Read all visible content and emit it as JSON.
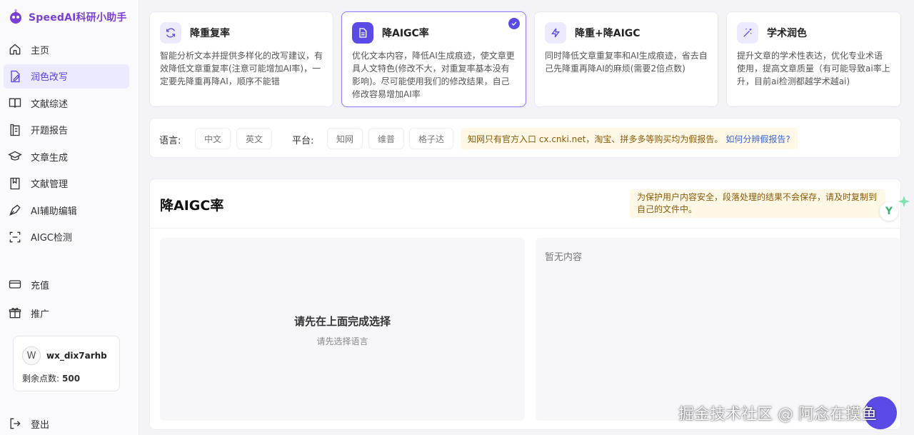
{
  "app": {
    "name": "SpeedAI科研小助手"
  },
  "sidebar": {
    "items": [
      {
        "label": "主页",
        "icon": "home-icon"
      },
      {
        "label": "润色改写",
        "icon": "edit-doc-icon",
        "active": true
      },
      {
        "label": "文献综述",
        "icon": "book-icon"
      },
      {
        "label": "开题报告",
        "icon": "report-icon"
      },
      {
        "label": "文章生成",
        "icon": "graduation-cap-icon"
      },
      {
        "label": "文献管理",
        "icon": "bookmark-icon"
      },
      {
        "label": "AI辅助编辑",
        "icon": "pen-icon"
      },
      {
        "label": "AIGC检测",
        "icon": "scan-icon"
      }
    ],
    "bottom": [
      {
        "label": "充值",
        "icon": "card-icon"
      },
      {
        "label": "推广",
        "icon": "gift-icon"
      }
    ],
    "user": {
      "avatar": "W",
      "name": "wx_dix7arhb",
      "points_label": "剩余点数:",
      "points": "500"
    },
    "logout": "登出"
  },
  "modes": [
    {
      "title": "降重复率",
      "icon": "refresh-icon",
      "desc": "智能分析文本并提供多样化的改写建议，有效降低文章重复率(注意可能增加AI率)，一定要先降重再降AI，顺序不能错"
    },
    {
      "title": "降AIGC率",
      "icon": "document-icon",
      "selected": true,
      "desc": "优化文本内容，降低AI生成痕迹，使文章更具人文特色(修改不大，对重复率基本没有影响)。尽可能使用我们的修改结果，自己修改容易增加AI率"
    },
    {
      "title": "降重+降AIGC",
      "icon": "lightning-icon",
      "desc": "同时降低文章重复率和AI生成痕迹，省去自己先降重再降AI的麻烦(需要2倍点数)"
    },
    {
      "title": "学术润色",
      "icon": "magic-wand-icon",
      "desc": "提升文章的学术性表达，优化专业术语使用，提高文章质量（有可能导致ai率上升，目前ai检测都越学术越ai)"
    }
  ],
  "options": {
    "language_label": "语言:",
    "languages": [
      "中文",
      "英文"
    ],
    "platform_label": "平台:",
    "platforms": [
      "知网",
      "维普",
      "格子达"
    ],
    "notice": "知网只有官方入口 cx.cnki.net，淘宝、拼多多等购买均为假报告。",
    "notice_link": "如何分辨假报告?"
  },
  "panel": {
    "title": "降AIGC率",
    "safety_notice": "为保护用户内容安全，段落处理的结果不会保存，请及时复制到自己的文件中。",
    "left_title": "请先在上面完成选择",
    "left_sub": "请先选择语言",
    "right_empty": "暂无内容"
  },
  "watermark": "掘金技术社区 @ 阿念在摸鱼",
  "colors": {
    "accent": "#5a4be6",
    "brand": "#7a3fd6",
    "notice_bg": "#fff8e6"
  }
}
